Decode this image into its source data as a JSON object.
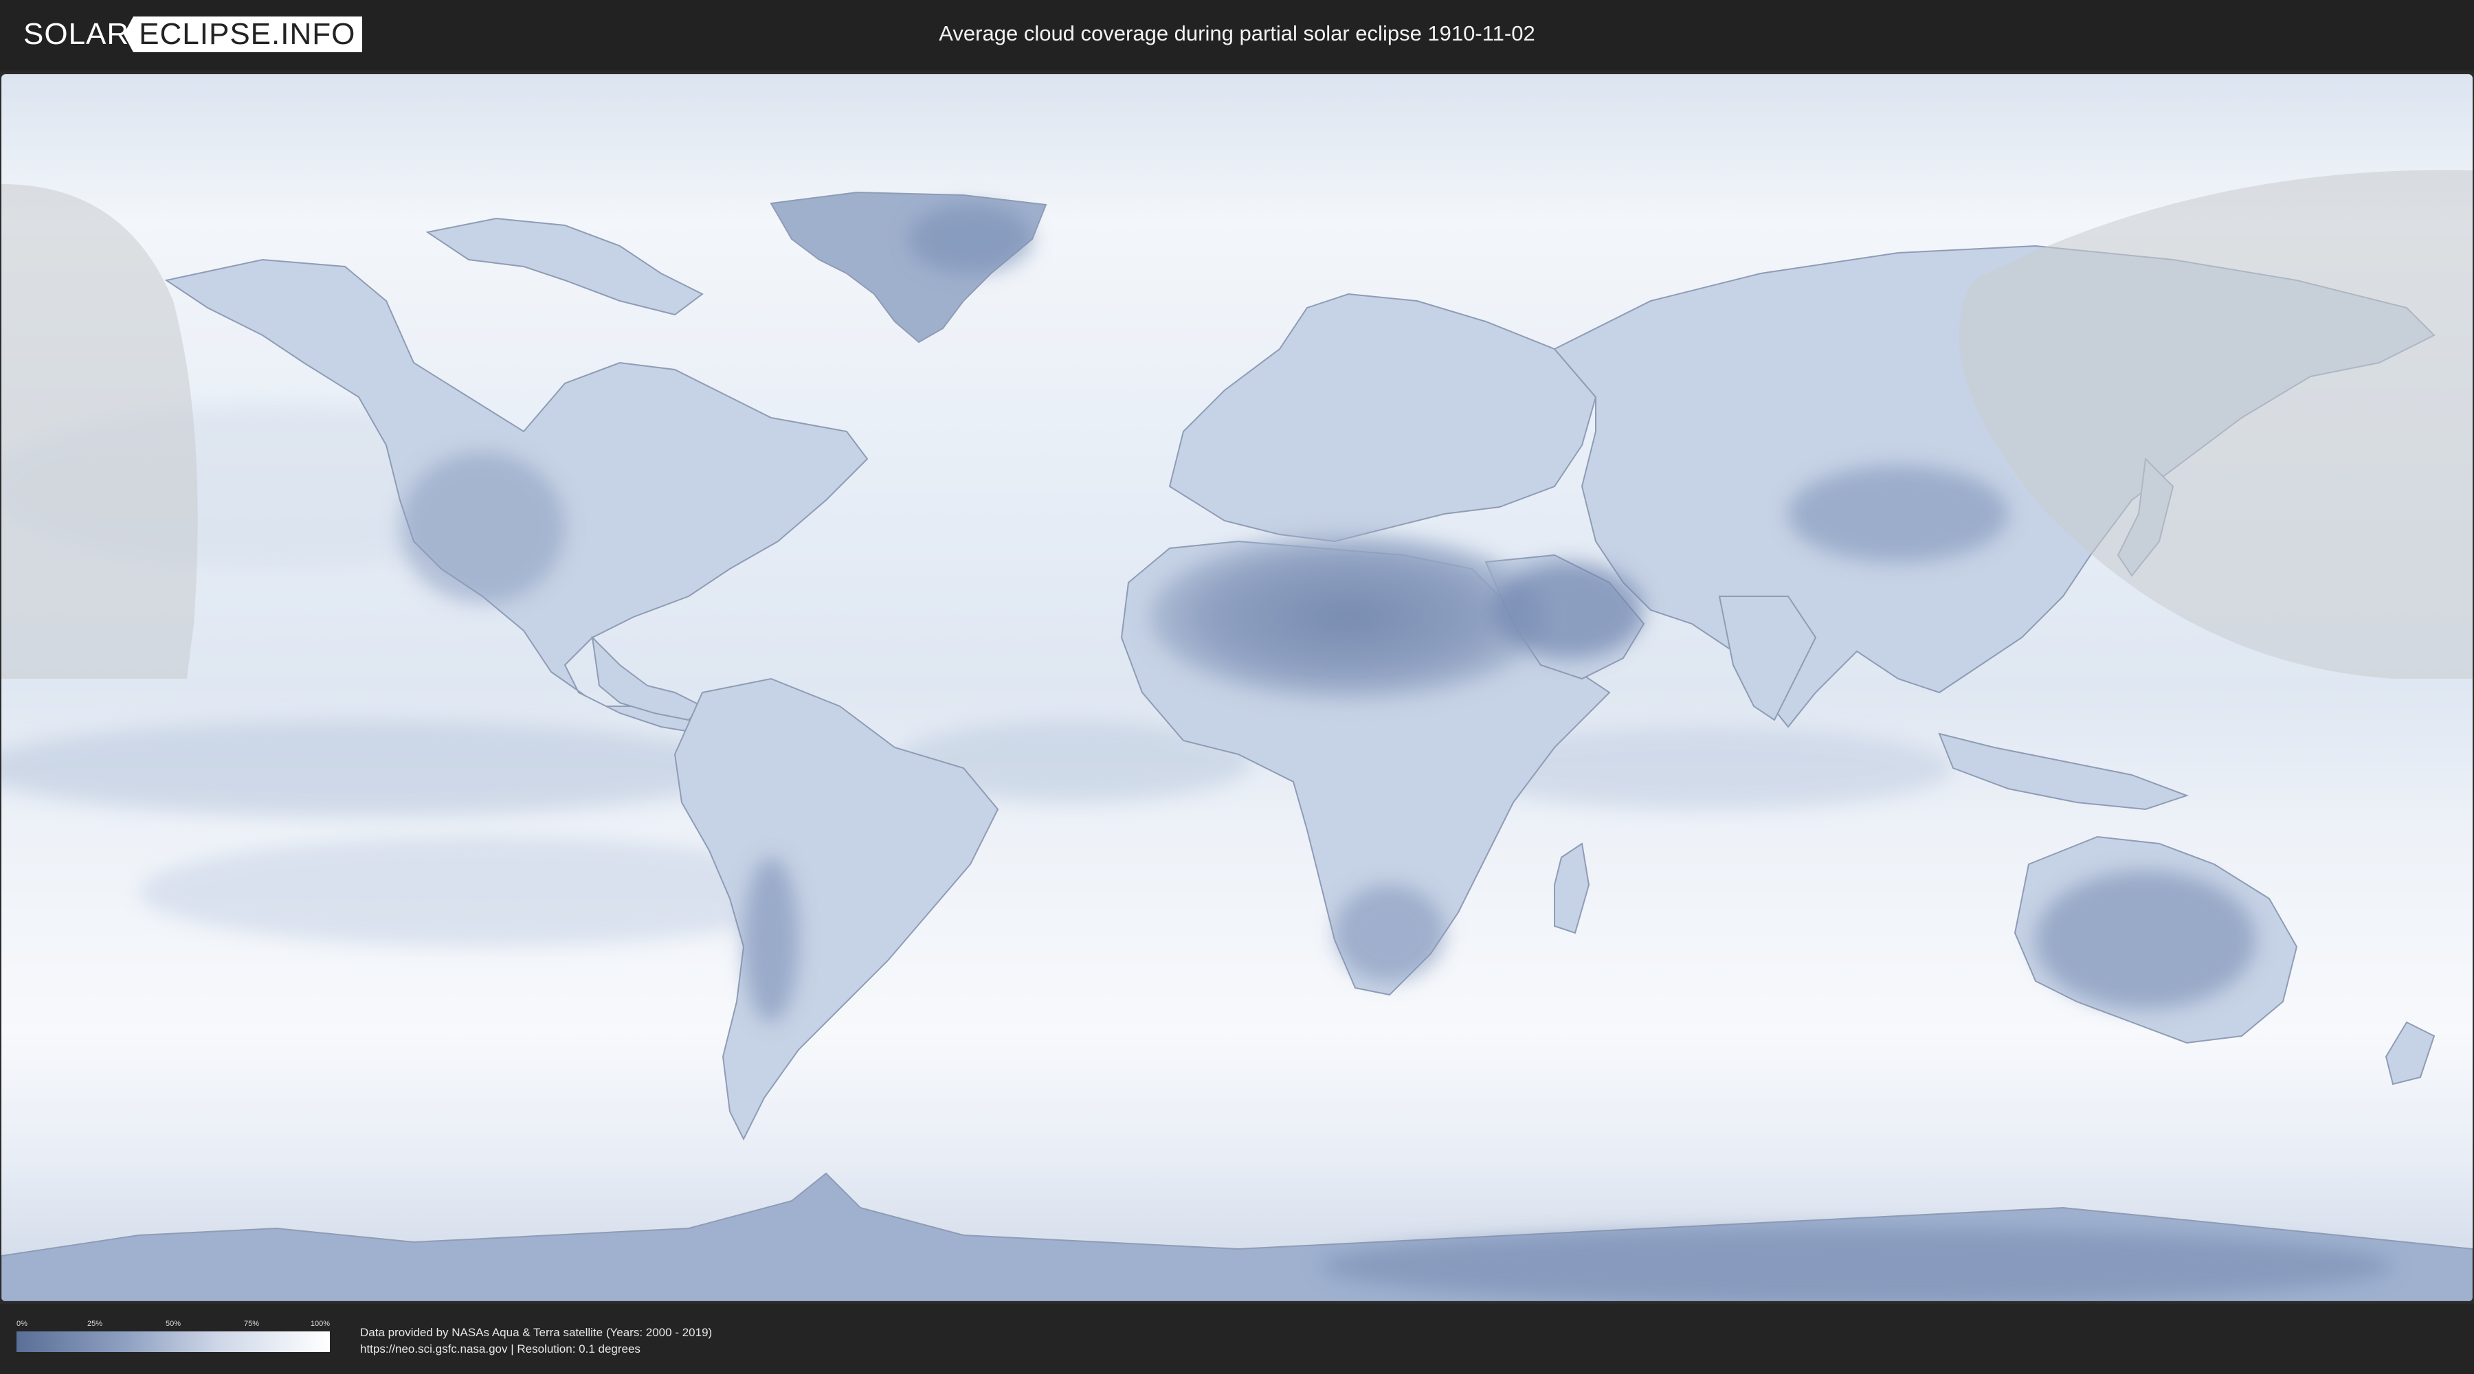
{
  "header": {
    "logo_solar": "SOLAR",
    "logo_rest": "ECLIPSE.INFO",
    "title": "Average cloud coverage during partial solar eclipse 1910-11-02"
  },
  "map": {
    "projection": "equirectangular",
    "layer": "average cloud coverage",
    "colors": {
      "ocean_clear": "#edf2f8",
      "land_clear": "#c3cfe3",
      "dense_dry": "#6d83ab",
      "eclipse_shade": "#d0d3d6",
      "coastline": "#8e9cb5"
    },
    "eclipse_zone": "partial eclipse visibility (shaded)"
  },
  "legend": {
    "ticks": [
      "0%",
      "25%",
      "50%",
      "75%",
      "100%"
    ],
    "scale_from": "#5a6f97",
    "scale_to": "#ffffff"
  },
  "credits": {
    "line1": "Data provided by NASAs Aqua & Terra satellite (Years: 2000 - 2019)",
    "line2": "https://neo.sci.gsfc.nasa.gov | Resolution: 0.1 degrees"
  }
}
